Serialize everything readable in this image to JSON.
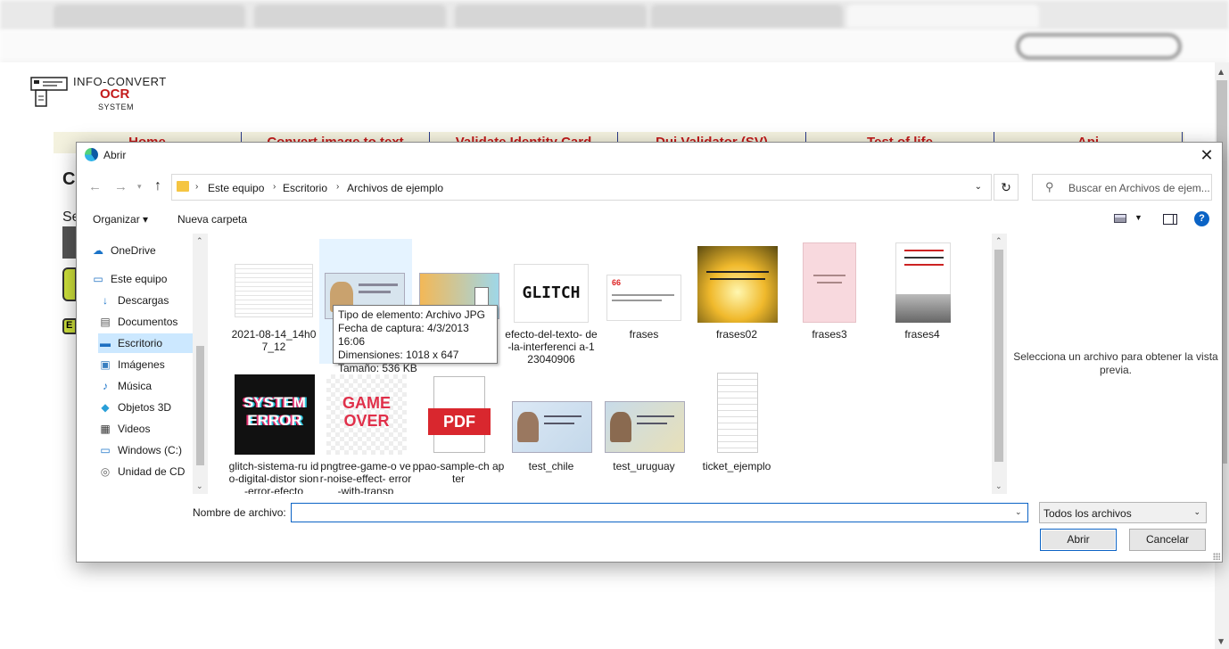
{
  "site": {
    "logo": {
      "line1": "INFO-CONVERT",
      "line2": "OCR",
      "line3": "SYSTEM"
    },
    "nav": [
      "Home",
      "Convert image to text",
      "Validate Identity Card",
      "Dui Validator (SV)",
      "Test of life",
      "Api"
    ],
    "peek_heading_letter": "C",
    "peek_text": "Se",
    "peek_badge": "E"
  },
  "dialog": {
    "title": "Abrir",
    "close_glyph": "✕",
    "breadcrumb": [
      "Este equipo",
      "Escritorio",
      "Archivos de ejemplo"
    ],
    "search_placeholder": "Buscar en Archivos de ejem...",
    "toolbar": {
      "organize": "Organizar ▾",
      "new_folder": "Nueva carpeta",
      "help": "?"
    },
    "sidebar": [
      {
        "label": "OneDrive",
        "icon": "cloud-icon"
      },
      {
        "label": "Este equipo",
        "icon": "computer-icon"
      },
      {
        "label": "Descargas",
        "icon": "download-icon"
      },
      {
        "label": "Documentos",
        "icon": "document-icon"
      },
      {
        "label": "Escritorio",
        "icon": "desktop-icon",
        "selected": true
      },
      {
        "label": "Imágenes",
        "icon": "pictures-icon"
      },
      {
        "label": "Música",
        "icon": "music-icon"
      },
      {
        "label": "Objetos 3D",
        "icon": "cube-icon"
      },
      {
        "label": "Videos",
        "icon": "video-icon"
      },
      {
        "label": "Windows (C:)",
        "icon": "drive-icon"
      },
      {
        "label": "Unidad de CD",
        "icon": "cd-icon"
      }
    ],
    "files": [
      {
        "name": "2021-08-14_14h0 7_12",
        "kind": "screenshot-doc"
      },
      {
        "name": "",
        "kind": "id-card",
        "hovered": true
      },
      {
        "name": "",
        "kind": "id-card-color"
      },
      {
        "name": "efecto-del-texto- de-la-interferenci a-123040906",
        "kind": "glitch"
      },
      {
        "name": "frases",
        "kind": "quote-card"
      },
      {
        "name": "frases02",
        "kind": "sunset-quote"
      },
      {
        "name": "frases3",
        "kind": "pink-quote"
      },
      {
        "name": "frases4",
        "kind": "exito-quote"
      },
      {
        "name": "glitch-sistema-ru ido-digital-distor sion-error-efecto",
        "kind": "system-error"
      },
      {
        "name": "pngtree-game-o ver-noise-effect- error-with-transp",
        "kind": "game-over"
      },
      {
        "name": "ppao-sample-ch apter",
        "kind": "pdf"
      },
      {
        "name": "test_chile",
        "kind": "id-chile"
      },
      {
        "name": "test_uruguay",
        "kind": "id-uruguay"
      },
      {
        "name": "ticket_ejemplo",
        "kind": "ticket"
      }
    ],
    "thumb_text": {
      "glitch": "GLITCH",
      "system_error_l1": "SYSTEM",
      "system_error_l2": "ERROR",
      "game_over_l1": "GAME",
      "game_over_l2": "OVER",
      "pdf": "PDF",
      "quote_mark": "66"
    },
    "tooltip": {
      "type": "Tipo de elemento: Archivo JPG",
      "date": "Fecha de captura: 4/3/2013 16:06",
      "dims": "Dimensiones: 1018 x 647",
      "size": "Tamaño: 536 KB"
    },
    "preview_text": "Selecciona un archivo para obtener la vista previa.",
    "filename_label": "Nombre de archivo:",
    "filename_value": "",
    "filetype": "Todos los archivos",
    "open_button": "Abrir",
    "cancel_button": "Cancelar"
  },
  "colors": {
    "accent": "#0b63c5",
    "nav_text": "#c31b1b",
    "selection": "#cce8ff",
    "hover_tile": "#e5f3ff"
  }
}
